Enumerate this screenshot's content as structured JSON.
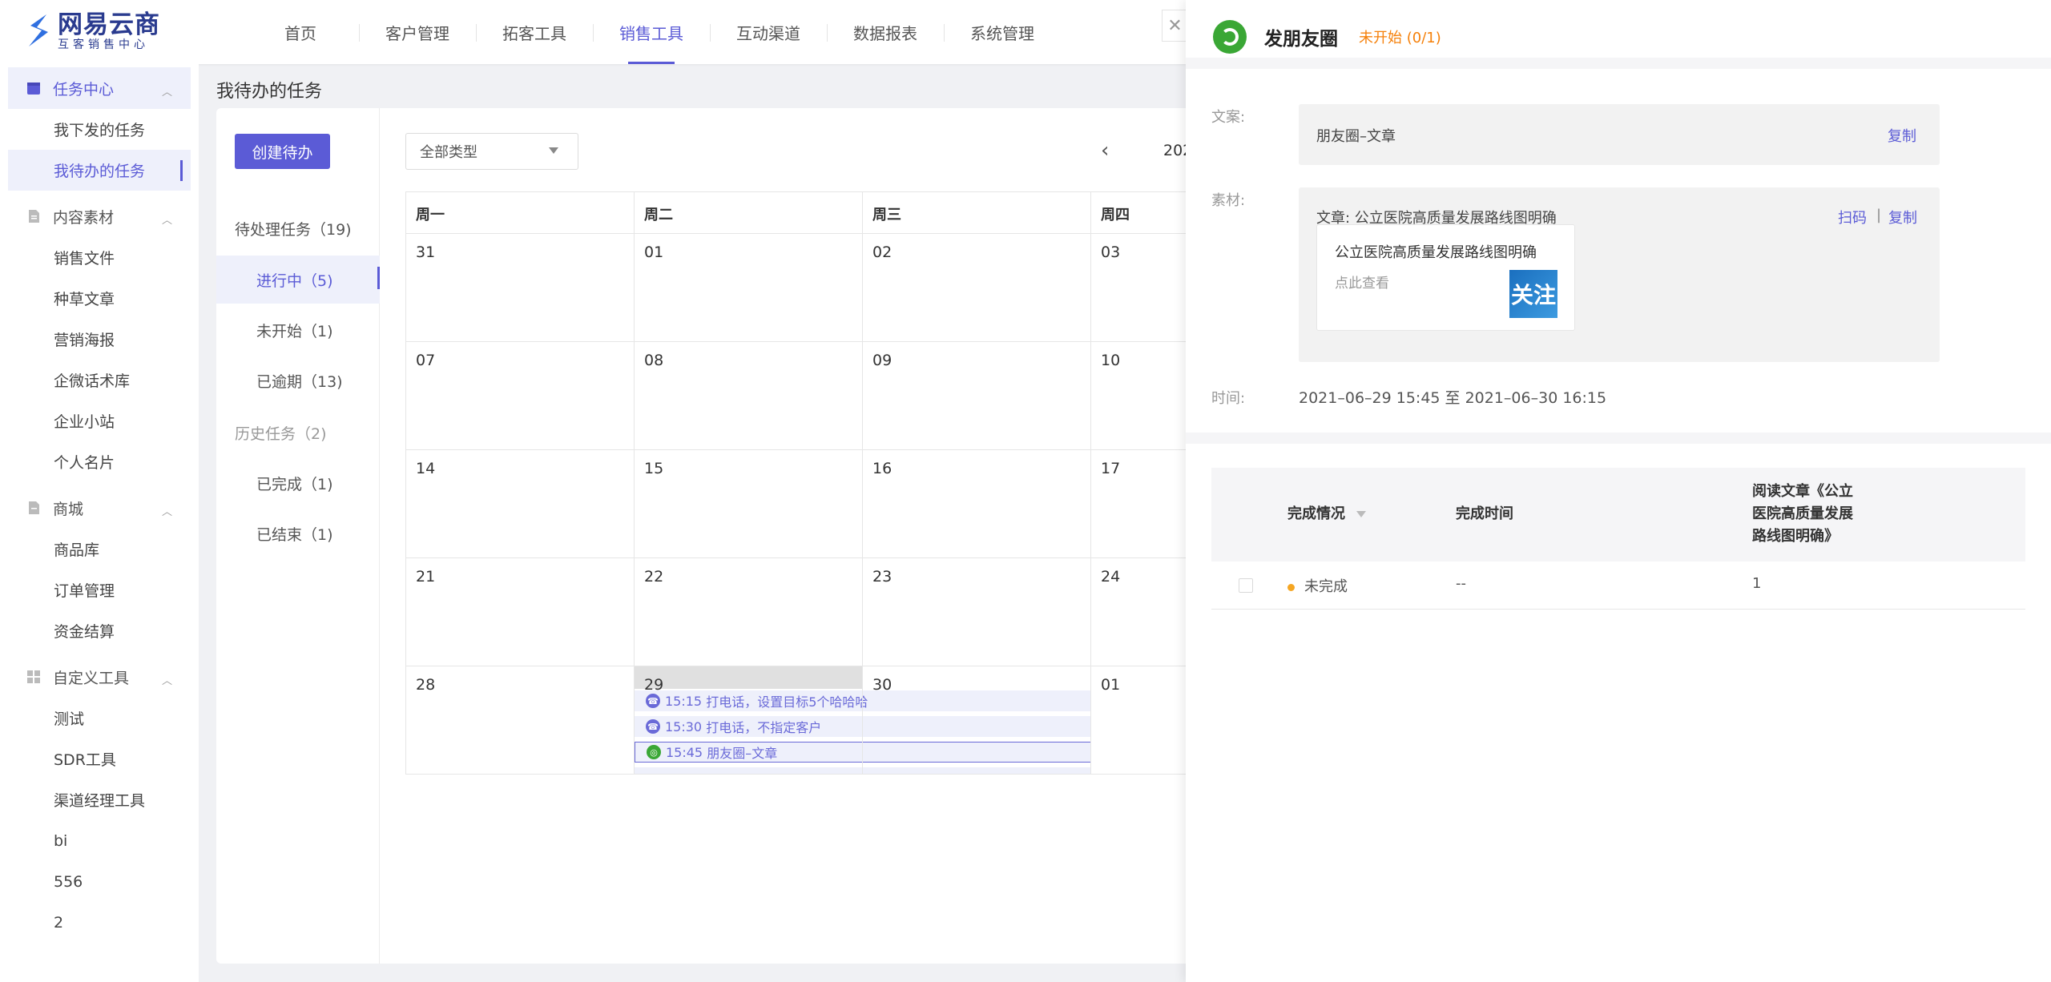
{
  "brand": {
    "name": "网易云商",
    "subtitle": "互客销售中心"
  },
  "nav": {
    "items": [
      "首页",
      "客户管理",
      "拓客工具",
      "销售工具",
      "互动渠道",
      "数据报表",
      "系统管理"
    ],
    "active_index": 3
  },
  "sidebar": {
    "groups": [
      {
        "label": "任务中心",
        "icon": "calendar-icon",
        "items": [
          "我下发的任务",
          "我待办的任务"
        ]
      },
      {
        "label": "内容素材",
        "icon": "document-icon",
        "items": [
          "销售文件",
          "种草文章",
          "营销海报",
          "企微话术库",
          "企业小站",
          "个人名片"
        ]
      },
      {
        "label": "商城",
        "icon": "shop-icon",
        "items": [
          "商品库",
          "订单管理",
          "资金结算"
        ]
      },
      {
        "label": "自定义工具",
        "icon": "grid-icon",
        "items": [
          "测试",
          "SDR工具",
          "渠道经理工具",
          "bi",
          "556",
          "2"
        ]
      }
    ]
  },
  "main": {
    "page_title": "我待办的任务",
    "create_button": "创建待办",
    "pending_label": "待处理任务（19)",
    "in_progress": "进行中（5)",
    "not_started": "未开始（1)",
    "overdue": "已逾期（13)",
    "history_label": "历史任务（2)",
    "completed": "已完成（1)",
    "ended": "已结束（1)",
    "type_filter": "全部类型",
    "year_partial": "202"
  },
  "calendar": {
    "weekdays": [
      "周一",
      "周二",
      "周三",
      "周四"
    ],
    "weeks": [
      [
        "31",
        "01",
        "02",
        "03"
      ],
      [
        "07",
        "08",
        "09",
        "10"
      ],
      [
        "14",
        "15",
        "16",
        "17"
      ],
      [
        "21",
        "22",
        "23",
        "24"
      ],
      [
        "28",
        "29",
        "30",
        "01"
      ]
    ],
    "events": [
      {
        "time": "15:15",
        "text": "打电话，设置目标5个哈哈哈",
        "icon": "phone-icon"
      },
      {
        "time": "15:30",
        "text": "打电话，不指定客户",
        "icon": "phone-icon"
      },
      {
        "time": "15:45",
        "text": "朋友圈–文章",
        "icon": "moments-icon"
      }
    ]
  },
  "drawer": {
    "title": "发朋友圈",
    "status": "未开始 (0/1)",
    "copy_label": "文案:",
    "copy_text": "朋友圈–文章",
    "copy_action": "复制",
    "material_label": "素材:",
    "material_text": "文章: 公立医院高质量发展路线图明确",
    "scan_action": "扫码",
    "separator": "|",
    "material_copy_action": "复制",
    "card_title": "公立医院高质量发展路线图明确",
    "card_sub": "点此查看",
    "thumb_text": "关注",
    "time_label": "时间:",
    "time_value": "2021–06–29 15:45 至 2021–06–30 16:15",
    "table": {
      "headers": [
        "完成情况",
        "完成时间",
        "阅读文章《公立",
        "医院高质量发展",
        "路线图明确》"
      ],
      "rows": [
        {
          "status": "未完成",
          "time": "--",
          "count": "1"
        }
      ]
    }
  },
  "colors": {
    "accent": "#5b5bd6",
    "warning": "#f5800a",
    "wechat_green": "#3aa735",
    "status_dot": "#f5a623"
  }
}
